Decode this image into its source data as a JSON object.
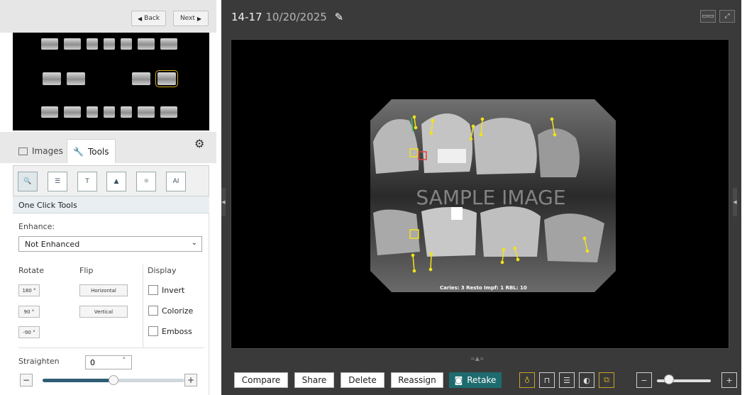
{
  "nav": {
    "back_label": "Back",
    "next_label": "Next"
  },
  "tabs": [
    {
      "label": "Images"
    },
    {
      "label": "Tools"
    }
  ],
  "panel": {
    "title": "One Click Tools",
    "enhance_label": "Enhance:",
    "enhance_value": "Not Enhanced",
    "rotate_label": "Rotate",
    "flip_label": "Flip",
    "display_label": "Display",
    "rotate_options": [
      "180 °",
      "90 °",
      "-90 °"
    ],
    "flip_options": [
      "Horizontal",
      "Vertical"
    ],
    "display_options": [
      "Invert",
      "Colorize",
      "Emboss"
    ],
    "straighten_label": "Straighten",
    "straighten_value": "0",
    "straighten_unit": "°",
    "slider_fraction": 0.5
  },
  "viewer": {
    "title_range": "14-17",
    "title_date": "10/20/2025",
    "watermark": "SAMPLE IMAGE",
    "stats": "Caries: 3 Resto Impf: 1 RBL: 10"
  },
  "toolbar": {
    "compare": "Compare",
    "share": "Share",
    "delete": "Delete",
    "reassign": "Reassign",
    "retake": "Retake"
  },
  "colors": {
    "accent": "#1e6b6f",
    "highlight": "#c9a227",
    "marker_yellow": "#f2e21a"
  }
}
